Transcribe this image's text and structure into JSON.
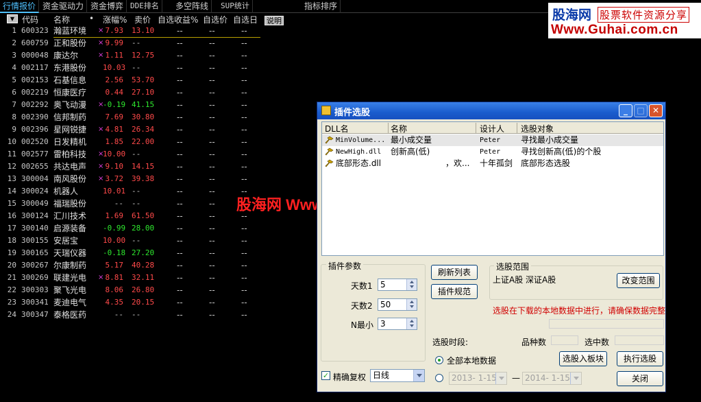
{
  "tabs": [
    "行情报价",
    "资金驱动力",
    "资金博弈",
    "DDE排名",
    "多空阵线",
    "SUP统计",
    "指标排序"
  ],
  "logo": {
    "brand": "股海网",
    "slogan": "股票软件资源分享",
    "url": "Www.Guhai.com.cn"
  },
  "table": {
    "headers": [
      "代码",
      "名称",
      "•",
      "涨幅%",
      "卖价",
      "自选收益%",
      "自选价",
      "自选日"
    ],
    "sort_icon": "sort-down-icon",
    "explain_button": "说明",
    "rows": [
      {
        "n": "1",
        "code": "600323",
        "name": "瀚蓝环境",
        "flag": "×",
        "pct": "7.93",
        "pct_color": "red",
        "price": "13.10",
        "price_color": "red",
        "d1": "--",
        "d2": "--",
        "d3": "--"
      },
      {
        "n": "2",
        "code": "600759",
        "name": "正和股份",
        "flag": "×",
        "pct": "9.99",
        "pct_color": "red",
        "price": "--",
        "price_color": "gray",
        "d1": "--",
        "d2": "--",
        "d3": "--"
      },
      {
        "n": "3",
        "code": "000048",
        "name": "康达尔",
        "flag": "×",
        "pct": "1.11",
        "pct_color": "red",
        "price": "12.75",
        "price_color": "red",
        "d1": "--",
        "d2": "--",
        "d3": "--"
      },
      {
        "n": "4",
        "code": "002117",
        "name": "东港股份",
        "flag": "",
        "pct": "10.03",
        "pct_color": "red",
        "price": "--",
        "price_color": "gray",
        "d1": "--",
        "d2": "--",
        "d3": "--"
      },
      {
        "n": "5",
        "code": "002153",
        "name": "石基信息",
        "flag": "",
        "pct": "2.56",
        "pct_color": "red",
        "price": "53.70",
        "price_color": "red",
        "d1": "--",
        "d2": "--",
        "d3": "--"
      },
      {
        "n": "6",
        "code": "002219",
        "name": "恒康医疗",
        "flag": "",
        "pct": "0.44",
        "pct_color": "red",
        "price": "27.10",
        "price_color": "red",
        "d1": "--",
        "d2": "--",
        "d3": "--"
      },
      {
        "n": "7",
        "code": "002292",
        "name": "奥飞动漫",
        "flag": "×",
        "pct": "-0.19",
        "pct_color": "green",
        "price": "41.15",
        "price_color": "green",
        "d1": "--",
        "d2": "--",
        "d3": "--"
      },
      {
        "n": "8",
        "code": "002390",
        "name": "信邦制药",
        "flag": "",
        "pct": "7.69",
        "pct_color": "red",
        "price": "30.80",
        "price_color": "red",
        "d1": "--",
        "d2": "--",
        "d3": "--"
      },
      {
        "n": "9",
        "code": "002396",
        "name": "星网锐捷",
        "flag": "×",
        "pct": "4.81",
        "pct_color": "red",
        "price": "26.34",
        "price_color": "red",
        "d1": "--",
        "d2": "--",
        "d3": "--"
      },
      {
        "n": "10",
        "code": "002520",
        "name": "日发精机",
        "flag": "",
        "pct": "1.85",
        "pct_color": "red",
        "price": "22.00",
        "price_color": "red",
        "d1": "--",
        "d2": "--",
        "d3": "--"
      },
      {
        "n": "11",
        "code": "002577",
        "name": "雷柏科技",
        "flag": "×",
        "pct": "10.00",
        "pct_color": "red",
        "price": "--",
        "price_color": "gray",
        "d1": "--",
        "d2": "--",
        "d3": "--"
      },
      {
        "n": "12",
        "code": "002655",
        "name": "共达电声",
        "flag": "×",
        "pct": "9.10",
        "pct_color": "red",
        "price": "14.15",
        "price_color": "red",
        "d1": "--",
        "d2": "--",
        "d3": "--"
      },
      {
        "n": "13",
        "code": "300004",
        "name": "南风股份",
        "flag": "×",
        "pct": "3.72",
        "pct_color": "red",
        "price": "39.38",
        "price_color": "red",
        "d1": "--",
        "d2": "--",
        "d3": "--"
      },
      {
        "n": "14",
        "code": "300024",
        "name": "机器人",
        "flag": "",
        "pct": "10.01",
        "pct_color": "red",
        "price": "--",
        "price_color": "gray",
        "d1": "--",
        "d2": "--",
        "d3": "--"
      },
      {
        "n": "15",
        "code": "300049",
        "name": "福瑞股份",
        "flag": "",
        "pct": "--",
        "pct_color": "gray",
        "price": "--",
        "price_color": "gray",
        "d1": "--",
        "d2": "--",
        "d3": "--"
      },
      {
        "n": "16",
        "code": "300124",
        "name": "汇川技术",
        "flag": "",
        "pct": "1.69",
        "pct_color": "red",
        "price": "61.50",
        "price_color": "red",
        "d1": "--",
        "d2": "--",
        "d3": "--"
      },
      {
        "n": "17",
        "code": "300140",
        "name": "启源装备",
        "flag": "",
        "pct": "-0.99",
        "pct_color": "green",
        "price": "28.00",
        "price_color": "green",
        "d1": "--",
        "d2": "--",
        "d3": "--"
      },
      {
        "n": "18",
        "code": "300155",
        "name": "安居宝",
        "flag": "",
        "pct": "10.00",
        "pct_color": "red",
        "price": "--",
        "price_color": "gray",
        "d1": "--",
        "d2": "--",
        "d3": "--"
      },
      {
        "n": "19",
        "code": "300165",
        "name": "天瑞仪器",
        "flag": "",
        "pct": "-0.18",
        "pct_color": "green",
        "price": "27.20",
        "price_color": "green",
        "d1": "--",
        "d2": "--",
        "d3": "--"
      },
      {
        "n": "20",
        "code": "300267",
        "name": "尔康制药",
        "flag": "",
        "pct": "5.17",
        "pct_color": "red",
        "price": "40.28",
        "price_color": "red",
        "d1": "--",
        "d2": "--",
        "d3": "--"
      },
      {
        "n": "21",
        "code": "300269",
        "name": "联建光电",
        "flag": "×",
        "pct": "8.81",
        "pct_color": "red",
        "price": "32.11",
        "price_color": "red",
        "d1": "--",
        "d2": "--",
        "d3": "--"
      },
      {
        "n": "22",
        "code": "300303",
        "name": "聚飞光电",
        "flag": "",
        "pct": "8.06",
        "pct_color": "red",
        "price": "26.80",
        "price_color": "red",
        "d1": "--",
        "d2": "--",
        "d3": "--"
      },
      {
        "n": "23",
        "code": "300341",
        "name": "麦迪电气",
        "flag": "",
        "pct": "4.35",
        "pct_color": "red",
        "price": "20.15",
        "price_color": "red",
        "d1": "--",
        "d2": "--",
        "d3": "--"
      },
      {
        "n": "24",
        "code": "300347",
        "name": "泰格医药",
        "flag": "",
        "pct": "--",
        "pct_color": "gray",
        "price": "--",
        "price_color": "gray",
        "d1": "--",
        "d2": "--",
        "d3": "--"
      }
    ]
  },
  "watermark": "股海网 Www.Guhai.Com.CN",
  "dialog": {
    "title": "插件选股",
    "title_buttons": {
      "min": "_",
      "max": "□",
      "close": "✕"
    },
    "list": {
      "headers": [
        "DLL名",
        "名称",
        "设计人",
        "选股对象"
      ],
      "rows": [
        {
          "dll": "MinVolume...",
          "name": "最小成交量",
          "designer": "Peter",
          "target": "寻找最小成交量"
        },
        {
          "dll": "NewHigh.dll",
          "name": "创新高(低)",
          "designer": "Peter",
          "target": "寻找创新高(低)的个股"
        },
        {
          "dll": "底部形态.dll",
          "name": "，欢...",
          "designer": "十年孤剑",
          "target": "底部形态选股"
        }
      ]
    },
    "params": {
      "group_title": "插件参数",
      "p1_label": "天数1",
      "p1_value": "5",
      "p2_label": "天数2",
      "p2_value": "50",
      "p3_label": "N最小",
      "p3_value": "3"
    },
    "refresh_button": "刷新列表",
    "spec_button": "插件规范",
    "range": {
      "group_title": "选股范围",
      "text": "上证A股 深证A股",
      "change_button": "改变范围"
    },
    "warning": "选股在下载的本地数据中进行，请确保数据完整",
    "period_label": "选股时段:",
    "variety_label": "品种数",
    "selected_label": "选中数",
    "all_data_label": "全部本地数据",
    "date_from": "2013- 1-15",
    "date_to": "2014- 1-15",
    "date_dash": "—",
    "to_block_button": "选股入板块",
    "run_button": "执行选股",
    "close_button": "关闭",
    "exact_label": "精确复权",
    "exact_checked": true,
    "period_value": "日线"
  },
  "colors": {
    "red": "#ff4a4a",
    "green": "#2ee82e",
    "gray": "#c8c8c8",
    "accent": "#4fc1ff"
  }
}
